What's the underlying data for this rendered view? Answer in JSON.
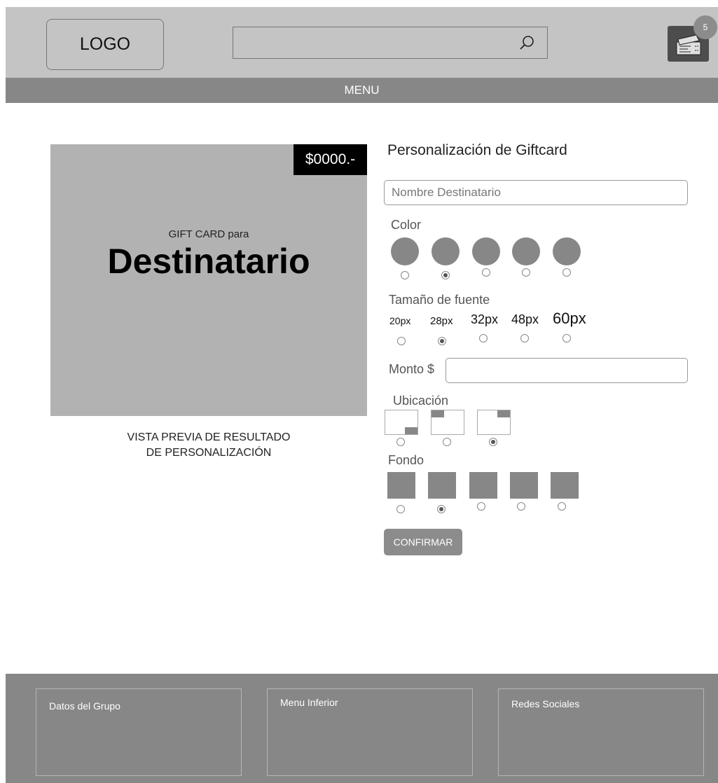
{
  "header": {
    "logo_text": "LOGO",
    "search": {
      "placeholder": ""
    },
    "cart": {
      "badge_count": "5",
      "icon": "ticket-icon"
    }
  },
  "menu": {
    "label": "MENU"
  },
  "preview": {
    "price": "$0000.-",
    "gift_for": "GIFT CARD para",
    "recipient": "Destinatario",
    "caption_line1": "VISTA PREVIA DE RESULTADO",
    "caption_line2": "DE PERSONALIZACIÓN"
  },
  "form": {
    "title": "Personalización de Giftcard",
    "recipient_placeholder": "Nombre Destinatario",
    "color_label": "Color",
    "color_selected_index": 1,
    "font_size_label": "Tamaño de fuente",
    "font_sizes": [
      "20px",
      "28px",
      "32px",
      "48px",
      "60px"
    ],
    "font_size_selected_index": 1,
    "amount_label": "Monto $",
    "amount_value": "",
    "location_label": "Ubicación",
    "location_selected_index": 2,
    "background_label": "Fondo",
    "background_selected_index": 1,
    "confirm_label": "CONFIRMAR"
  },
  "footer": {
    "group_data": "Datos del Grupo",
    "bottom_menu": "Menu Inferior",
    "social": "Redes Sociales"
  },
  "colors": {
    "header_bg": "#c4c4c4",
    "bar_gray": "#878787",
    "preview_bg": "#b2b2b2",
    "swatch": "#878787"
  }
}
